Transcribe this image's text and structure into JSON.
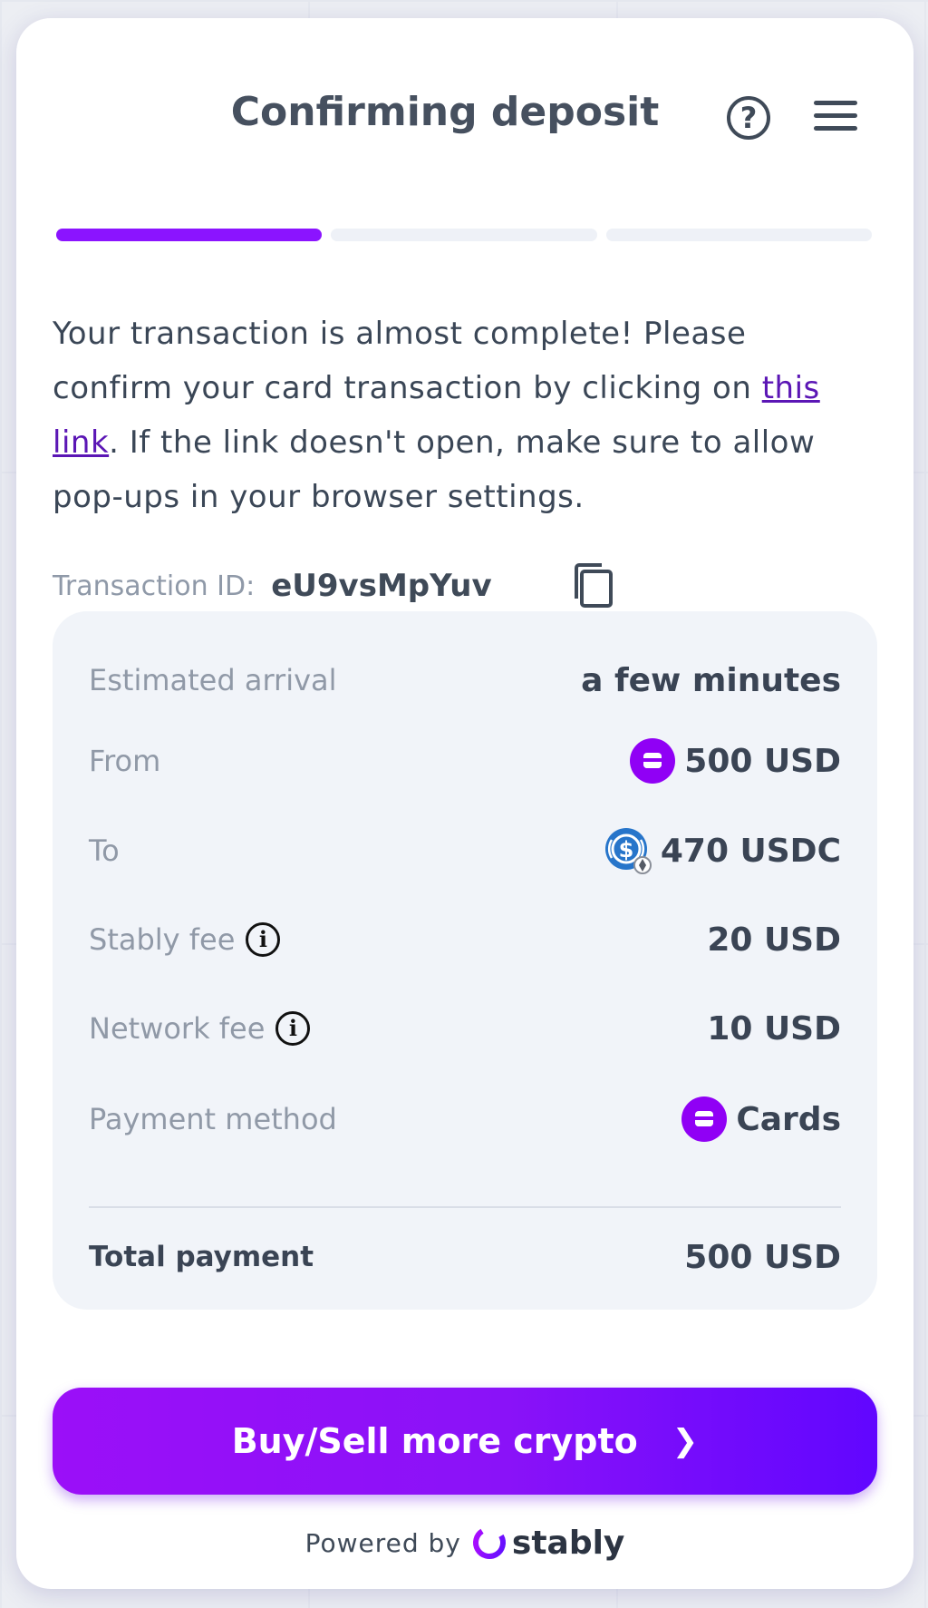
{
  "header": {
    "title": "Confirming deposit",
    "help_icon": "question-circle-icon",
    "menu_icon": "hamburger-menu-icon"
  },
  "progress": {
    "steps": 3,
    "current_step": 1,
    "active_color": "#8b14ff",
    "inactive_color": "#eef1f7"
  },
  "message": {
    "part1": "Your transaction is almost complete! Please confirm your card transaction by clicking on ",
    "link_text": "this link",
    "part2": ". If the link doesn't open, make sure to allow pop-ups in your browser settings."
  },
  "transaction": {
    "label": "Transaction ID:",
    "id": "eU9vsMpYuv",
    "copy_icon": "copy-icon"
  },
  "details": {
    "estimated_arrival": {
      "label": "Estimated arrival",
      "value": "a few minutes"
    },
    "from": {
      "label": "From",
      "value": "500 USD",
      "icon": "card-icon"
    },
    "to": {
      "label": "To",
      "value": "470 USDC",
      "icon": "usdc-icon"
    },
    "stably_fee": {
      "label": "Stably fee",
      "value": "20 USD",
      "icon": "info-icon"
    },
    "network_fee": {
      "label": "Network fee",
      "value": "10 USD",
      "icon": "info-icon"
    },
    "payment_method": {
      "label": "Payment method",
      "value": "Cards",
      "icon": "card-icon"
    },
    "total": {
      "label": "Total payment",
      "value": "500 USD"
    }
  },
  "cta": {
    "label": "Buy/Sell more crypto",
    "icon": "chevron-right-icon"
  },
  "footer": {
    "powered_by": "Powered by",
    "brand": "stably"
  },
  "colors": {
    "brand_purple": "#8b14ff",
    "link": "#5b16b5",
    "panel_bg": "#f1f4f9"
  }
}
